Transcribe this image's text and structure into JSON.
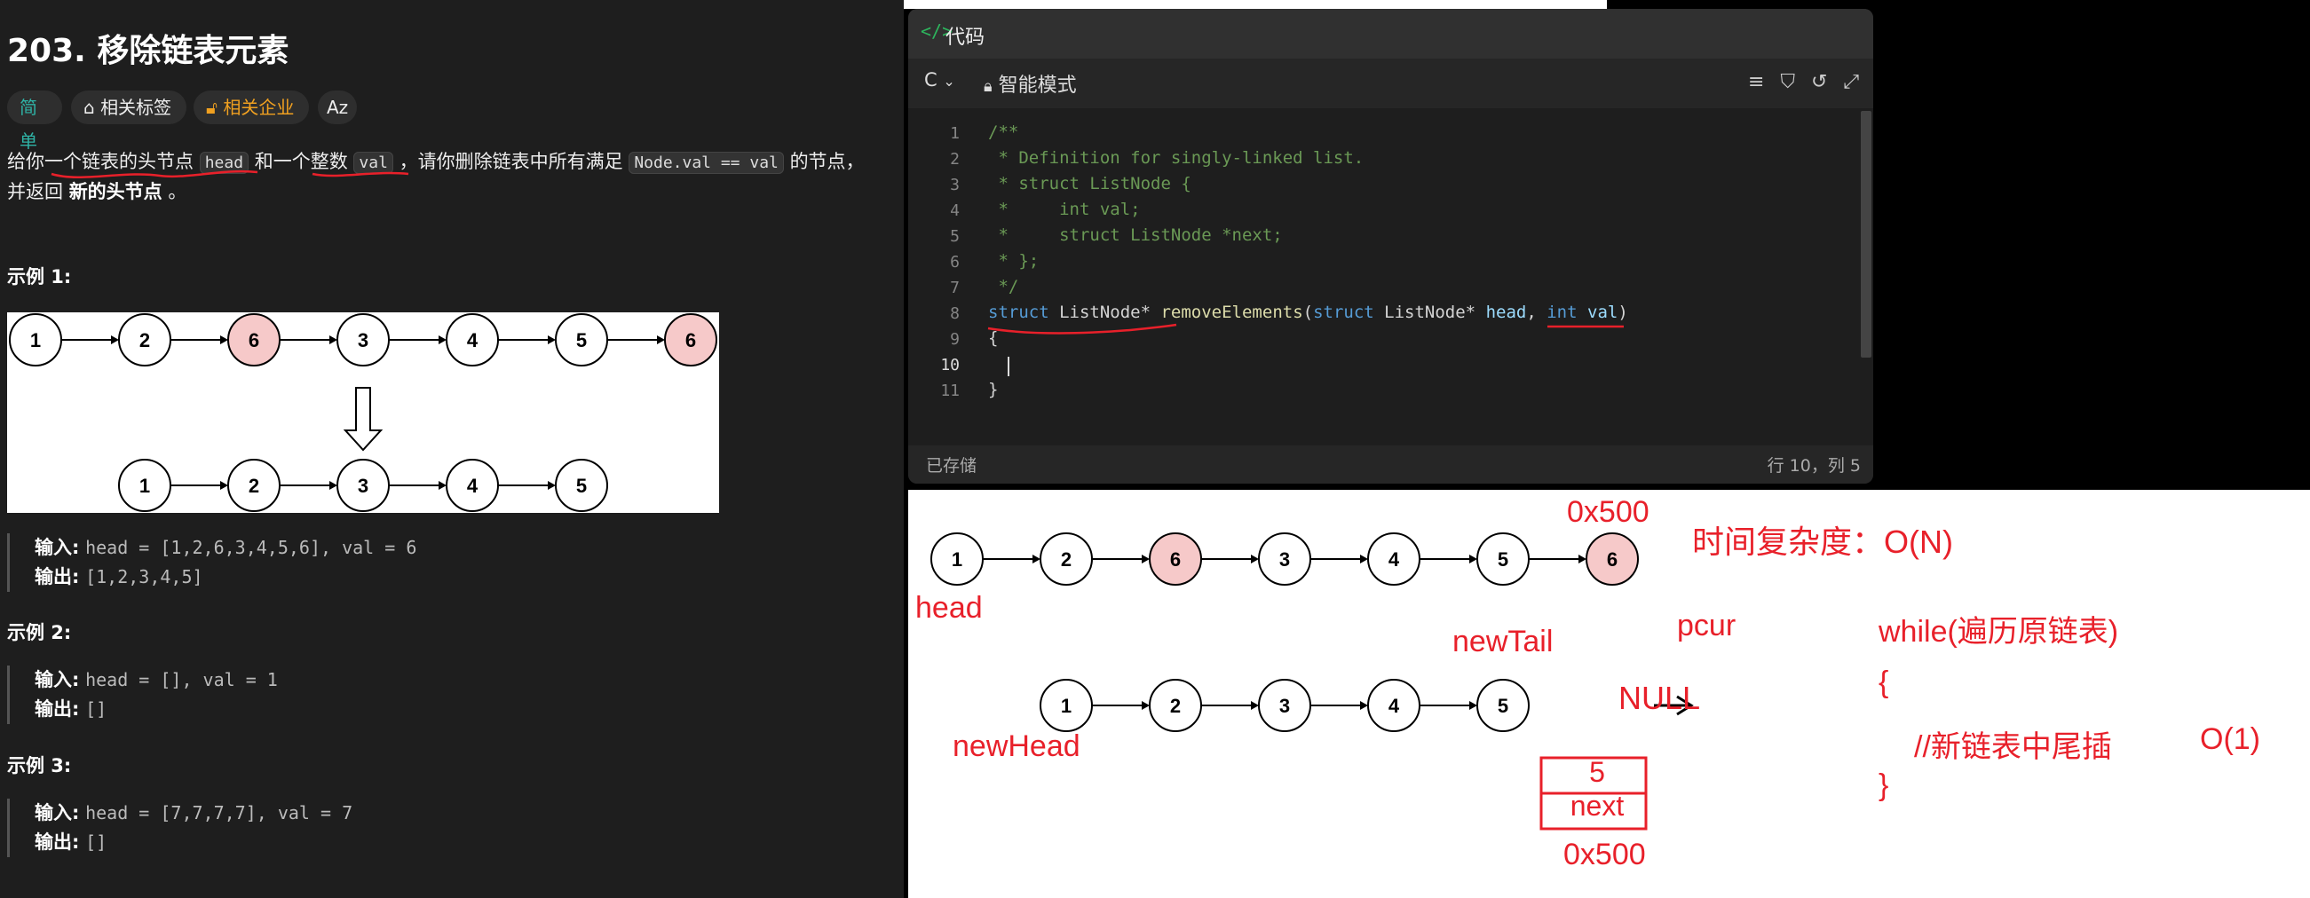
{
  "problem": {
    "title": "203. 移除链表元素",
    "tags": {
      "easy": "简单",
      "topics": "相关标签",
      "companies": "相关企业",
      "translate": "Aᴢ"
    },
    "desc_1": "给你一个链表的头节点",
    "desc_code_head": "head",
    "desc_2": "和一个整数",
    "desc_code_val": "val",
    "desc_3": "，请你删除链表中所有满足",
    "desc_code_cond": "Node.val == val",
    "desc_4": "的节点，",
    "desc_5a": "并返回",
    "desc_5b": "新的头节点",
    "desc_5c": "。",
    "examples": [
      {
        "title": "示例 1:",
        "input_label": "输入:",
        "input": "head = [1,2,6,3,4,5,6], val = 6",
        "output_label": "输出:",
        "output": "[1,2,3,4,5]"
      },
      {
        "title": "示例 2:",
        "input_label": "输入:",
        "input": "head = [], val = 1",
        "output_label": "输出:",
        "output": "[]"
      },
      {
        "title": "示例 3:",
        "input_label": "输入:",
        "input": "head = [7,7,7,7], val = 7",
        "output_label": "输出:",
        "output": "[]"
      }
    ],
    "diagram": {
      "top": [
        "1",
        "2",
        "6",
        "3",
        "4",
        "5",
        "6"
      ],
      "bottom": [
        "1",
        "2",
        "3",
        "4",
        "5"
      ],
      "highlight": "#f6c9c9"
    }
  },
  "editor": {
    "title": "代码",
    "lang": "C",
    "mode": "智能模式",
    "status_saved": "已存储",
    "status_pos": "行 10，列 5",
    "line_numbers": [
      "1",
      "2",
      "3",
      "4",
      "5",
      "6",
      "7",
      "8",
      "9",
      "10",
      "11"
    ],
    "lines": {
      "l1": "/**",
      "l2": " * Definition for singly-linked list.",
      "l3": " * struct ListNode {",
      "l4": " *     int val;",
      "l5": " *     struct ListNode *next;",
      "l6": " * };",
      "l7": " */",
      "l8_kw1": "struct",
      "l8_t1": " ListNode* ",
      "l8_fn": "removeElements",
      "l8_p1": "(",
      "l8_kw2": "struct",
      "l8_t2": " ListNode* ",
      "l8_pm1": "head",
      "l8_t3": ", ",
      "l8_kw3": "int",
      "l8_t4": " ",
      "l8_pm2": "val",
      "l8_t5": ")",
      "l9": "{",
      "l10": "",
      "l11": "}"
    }
  },
  "whiteboard": {
    "row1": [
      "1",
      "2",
      "6",
      "3",
      "4",
      "5",
      "6"
    ],
    "row2": [
      "1",
      "2",
      "3",
      "4",
      "5"
    ],
    "addr_top": "0x500",
    "addr_bottom": "0x500",
    "label_head": "head",
    "label_newtail": "newTail",
    "label_pcur": "pcur",
    "label_null": "NULL",
    "label_newhead": "newHead",
    "time_complexity": "时间复杂度：O(N)",
    "while_line": "while(遍历原链表)",
    "brace_open": "{",
    "comment_line": "//新链表中尾插",
    "o1": "O(1)",
    "brace_close": "}",
    "box_val": "5",
    "box_next": "next",
    "ink_color": "#e8202a"
  }
}
